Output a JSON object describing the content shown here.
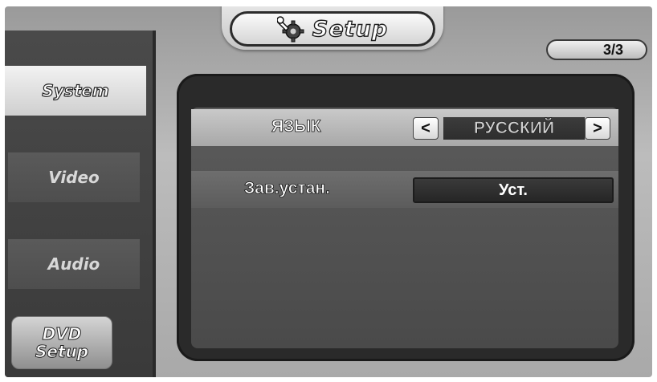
{
  "header": {
    "title": "Setup",
    "icon": "wrench-gear-icon",
    "page_indicator": "3/3"
  },
  "sidebar": {
    "items": [
      {
        "label": "System",
        "active": true
      },
      {
        "label": "Video",
        "active": false
      },
      {
        "label": "Audio",
        "active": false
      },
      {
        "label": "DVD\nSetup",
        "active": false
      }
    ]
  },
  "settings": {
    "language": {
      "label": "ЯЗЫК",
      "value": "РУССКИЙ",
      "prev_symbol": "<",
      "next_symbol": ">"
    },
    "factory_reset": {
      "label": "Зав.устан.",
      "button_label": "Уст."
    }
  },
  "colors": {
    "sidebar_dark": "#4a4a4a",
    "active_tab": "#e6e6e6",
    "panel": "#2a2a2a"
  }
}
